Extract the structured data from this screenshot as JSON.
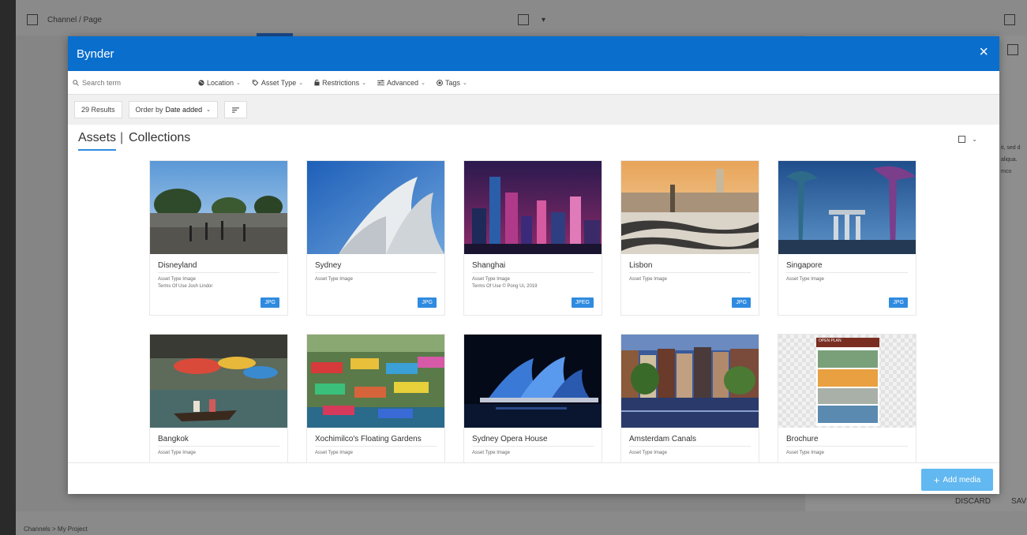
{
  "background": {
    "breadcrumb_top": "Channel  /  Page",
    "breadcrumb_bottom": "Channels  >  My Project",
    "panel_text": [
      "it, sed d",
      "aliqua.",
      "mco"
    ],
    "discard": "DISCARD",
    "save": "SAV"
  },
  "modal": {
    "title": "Bynder",
    "close": "×"
  },
  "filters": {
    "search_placeholder": "Search term",
    "items": [
      "Location",
      "Asset Type",
      "Restrictions",
      "Advanced",
      "Tags"
    ]
  },
  "results": {
    "count": "29 Results",
    "order_label": "Order by",
    "order_value": "Date added"
  },
  "tabs": {
    "assets": "Assets",
    "separator": "|",
    "collections": "Collections"
  },
  "assets": [
    {
      "name": "Disneyland",
      "meta": [
        "Asset Type  Image",
        "Terms Of Use  Josh Lindor"
      ],
      "badge": "JPG"
    },
    {
      "name": "Sydney",
      "meta": [
        "Asset Type  Image"
      ],
      "badge": "JPG"
    },
    {
      "name": "Shanghai",
      "meta": [
        "Asset Type  Image",
        "Terms Of Use  © Pong Ui, 2019"
      ],
      "badge": "JPEG"
    },
    {
      "name": "Lisbon",
      "meta": [
        "Asset Type  Image"
      ],
      "badge": "JPG"
    },
    {
      "name": "Singapore",
      "meta": [
        "Asset Type  Image"
      ],
      "badge": "JPG"
    },
    {
      "name": "Bangkok",
      "meta": [
        "Asset Type  Image"
      ],
      "badge": ""
    },
    {
      "name": "Xochimilco's Floating Gardens",
      "meta": [
        "Asset Type  Image"
      ],
      "badge": ""
    },
    {
      "name": "Sydney Opera House",
      "meta": [
        "Asset Type  Image"
      ],
      "badge": ""
    },
    {
      "name": "Amsterdam Canals",
      "meta": [
        "Asset Type  Image"
      ],
      "badge": ""
    },
    {
      "name": "Brochure",
      "meta": [
        "Asset Type  Image"
      ],
      "badge": "",
      "thumb_text": "OPEN PLAN"
    }
  ],
  "footer": {
    "add_media": "Add media"
  },
  "colors": {
    "header": "#0a6ecd",
    "accent": "#2f8be0",
    "add_media": "#62b8f0"
  }
}
